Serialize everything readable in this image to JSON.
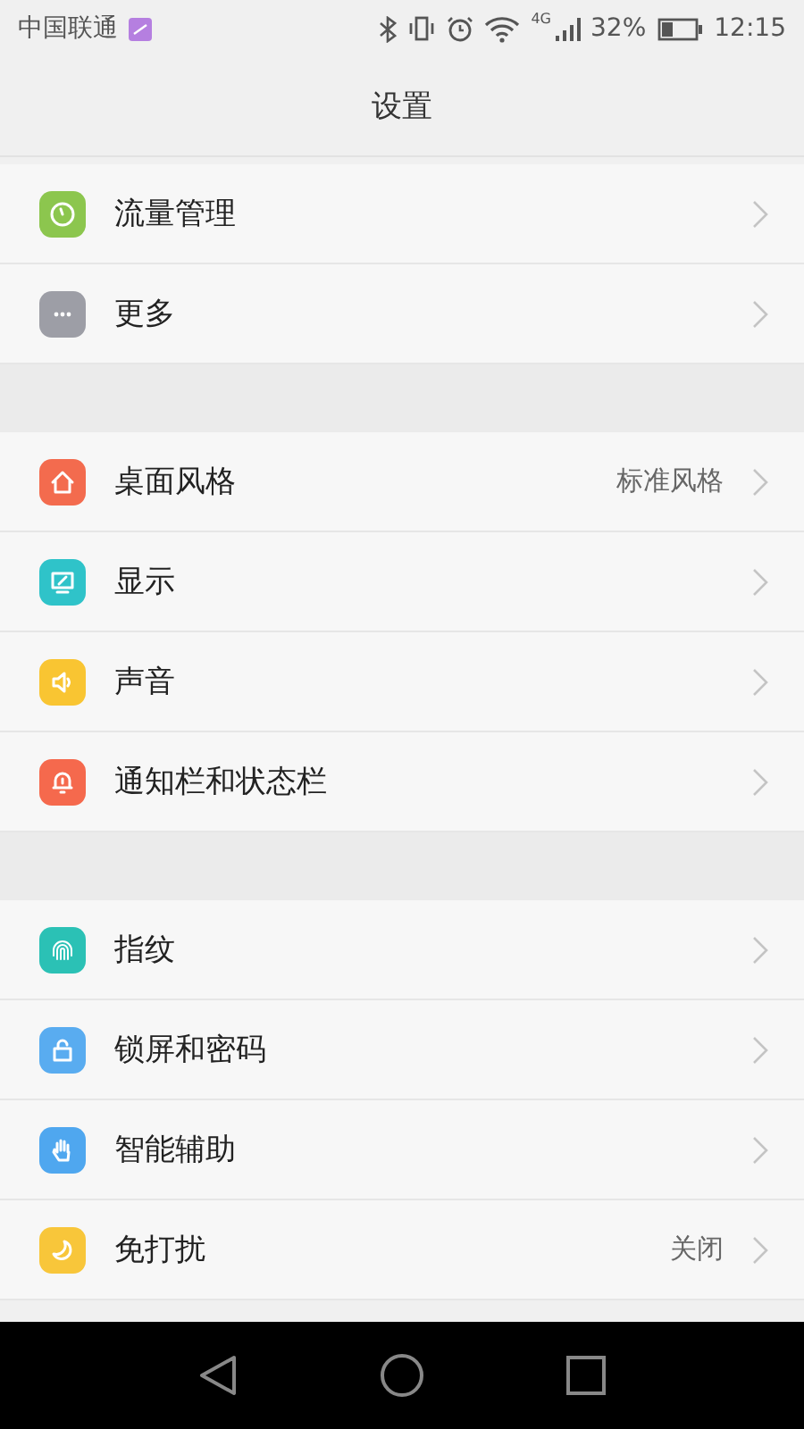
{
  "status_bar": {
    "carrier": "中国联通",
    "network": "4G",
    "battery": "32%",
    "time": "12:15"
  },
  "header": {
    "title": "设置"
  },
  "groups": [
    {
      "items": [
        {
          "label": "流量管理",
          "color": "#8cc64e"
        },
        {
          "label": "更多",
          "color": "#9d9ea6"
        }
      ]
    },
    {
      "items": [
        {
          "label": "桌面风格",
          "value": "标准风格",
          "color": "#f36b4e"
        },
        {
          "label": "显示",
          "color": "#2fc3c9"
        },
        {
          "label": "声音",
          "color": "#f9c532"
        },
        {
          "label": "通知栏和状态栏",
          "color": "#f5694d"
        }
      ]
    },
    {
      "items": [
        {
          "label": "指纹",
          "color": "#2bc1b5"
        },
        {
          "label": "锁屏和密码",
          "color": "#59acf0"
        },
        {
          "label": "智能辅助",
          "color": "#4fa7ef"
        },
        {
          "label": "免打扰",
          "value": "关闭",
          "color": "#f8c63a"
        }
      ]
    }
  ]
}
